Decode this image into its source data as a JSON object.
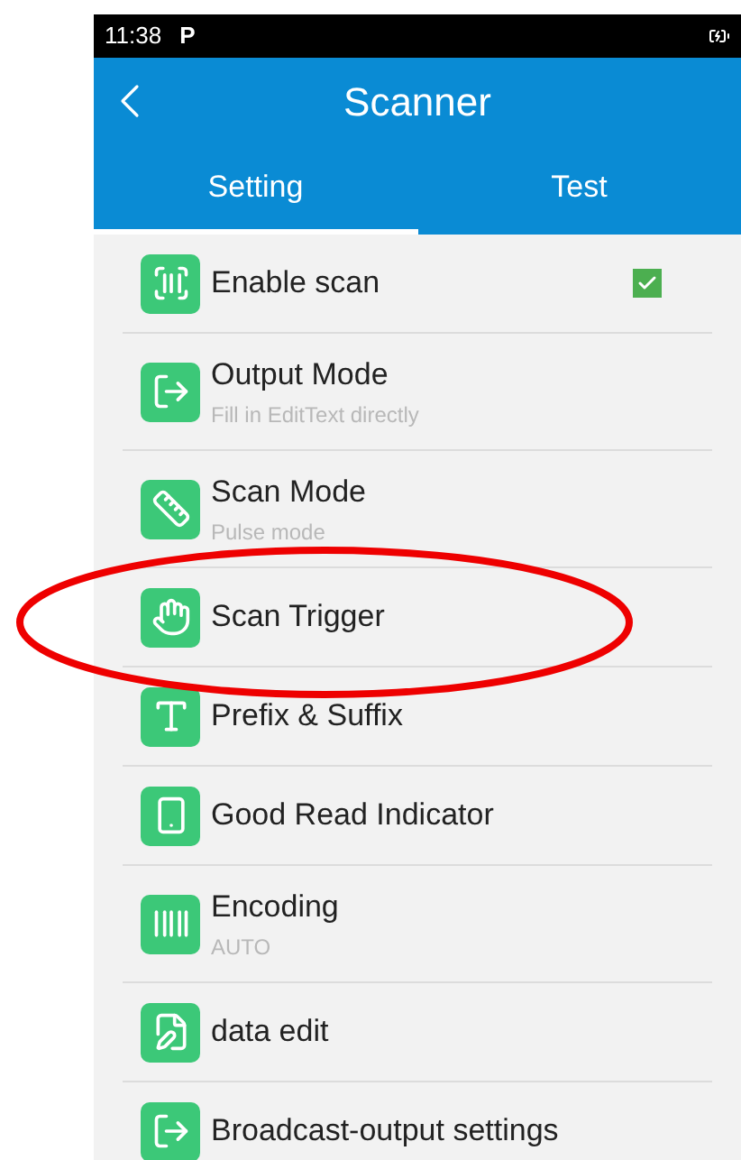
{
  "status_bar": {
    "time": "11:38",
    "notification": "P"
  },
  "header": {
    "title": "Scanner"
  },
  "tabs": [
    {
      "label": "Setting",
      "selected": true
    },
    {
      "label": "Test",
      "selected": false
    }
  ],
  "settings": [
    {
      "kind": "checkbox",
      "title": "Enable scan",
      "checked": true
    },
    {
      "kind": "plain",
      "title": "Output Mode",
      "subtitle": "Fill in EditText directly"
    },
    {
      "kind": "plain",
      "title": "Scan Mode",
      "subtitle": "Pulse mode"
    },
    {
      "kind": "plain",
      "title": "Scan Trigger"
    },
    {
      "kind": "plain",
      "title": "Prefix & Suffix"
    },
    {
      "kind": "plain",
      "title": "Good Read Indicator"
    },
    {
      "kind": "plain",
      "title": "Encoding",
      "subtitle": "AUTO"
    },
    {
      "kind": "plain",
      "title": "data edit"
    },
    {
      "kind": "plain",
      "title": "Broadcast-output settings"
    }
  ]
}
